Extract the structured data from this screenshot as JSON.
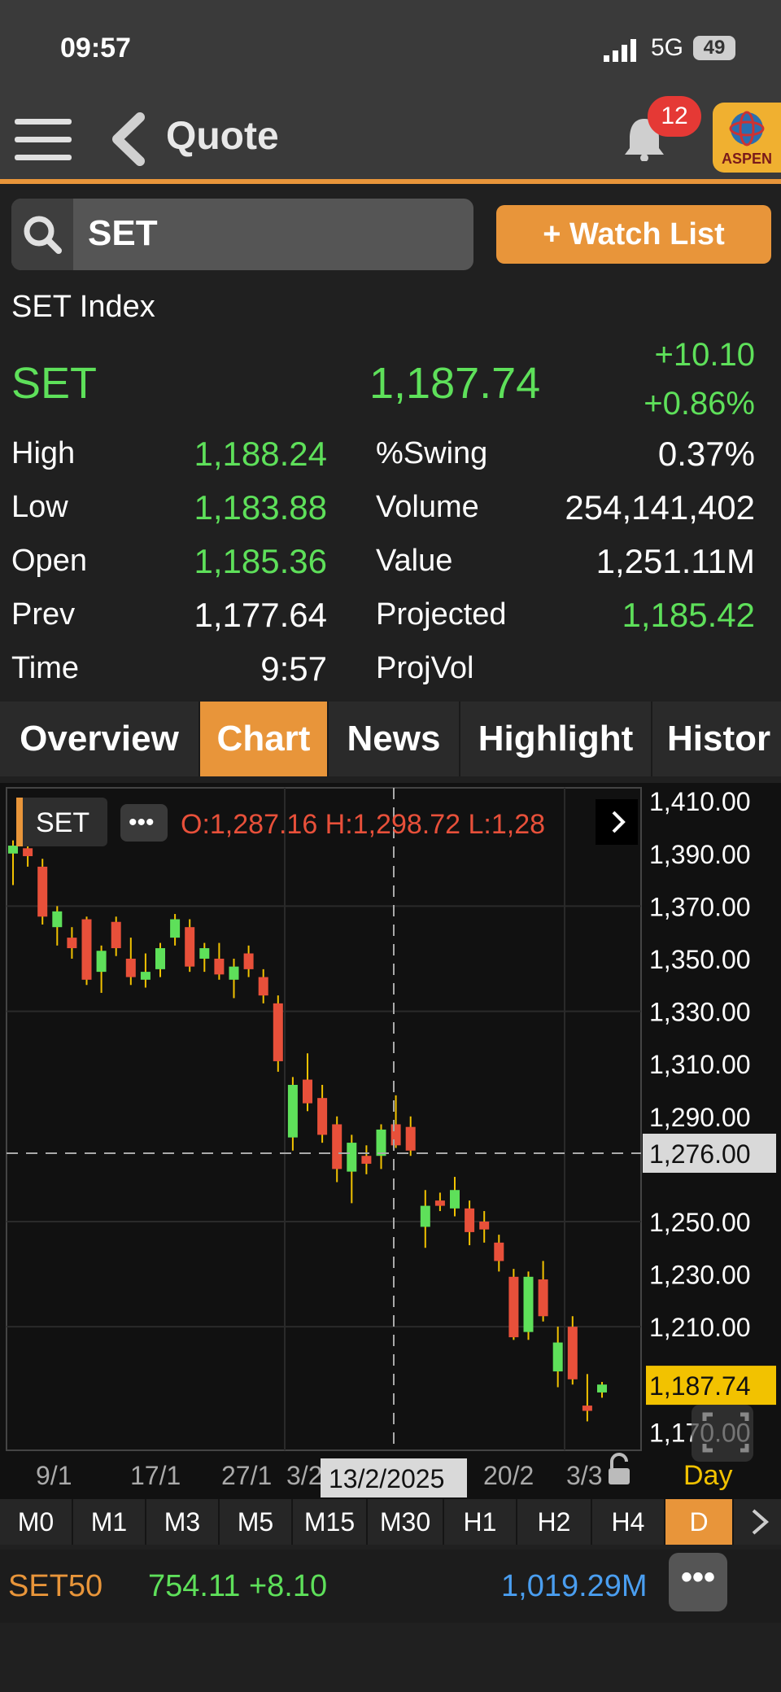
{
  "status_bar": {
    "time": "09:57",
    "network": "5G",
    "battery": "49"
  },
  "header": {
    "title": "Quote",
    "notification_count": "12",
    "logo_text": "ASPEN"
  },
  "search": {
    "value": "SET",
    "watchlist_label": "+ Watch List"
  },
  "quote": {
    "index_name": "SET Index",
    "symbol": "SET",
    "last": "1,187.74",
    "change": "+10.10",
    "change_pct": "+0.86%",
    "left_rows": [
      {
        "label": "High",
        "value": "1,188.24"
      },
      {
        "label": "Low",
        "value": "1,183.88"
      },
      {
        "label": "Open",
        "value": "1,185.36"
      },
      {
        "label": "Prev",
        "value": "1,177.64"
      },
      {
        "label": "Time",
        "value": "9:57"
      }
    ],
    "right_rows": [
      {
        "label": "%Swing",
        "value": "0.37%"
      },
      {
        "label": "Volume",
        "value": "254,141,402"
      },
      {
        "label": "Value",
        "value": "1,251.11M"
      },
      {
        "label": "Projected",
        "value": "1,185.42"
      },
      {
        "label": "ProjVol",
        "value": ""
      }
    ]
  },
  "tabs": [
    "Overview",
    "Chart",
    "News",
    "Highlight",
    "Histor"
  ],
  "active_tab": "Chart",
  "chart_header": {
    "symbol": "SET",
    "ohlc": "O:1,287.16  H:1,298.72  L:1,28"
  },
  "chart_data": {
    "type": "candlestick",
    "y_ticks": [
      "1,410.00",
      "1,390.00",
      "1,370.00",
      "1,350.00",
      "1,330.00",
      "1,310.00",
      "1,290.00",
      "1,250.00",
      "1,230.00",
      "1,210.00",
      "1,170.00"
    ],
    "ylim": [
      1163,
      1415
    ],
    "x_tick_labels": [
      "9/1",
      "17/1",
      "27/1",
      "3/2",
      "20/2",
      "3/3"
    ],
    "crosshair_price": "1,276.00",
    "crosshair_value": 1276,
    "crosshair_date": "13/2/2025",
    "last_price_label": "1,187.74",
    "last_price_value": 1187.74,
    "period_label": "Day",
    "candles": [
      {
        "o": 1390,
        "h": 1395,
        "l": 1378,
        "c": 1393,
        "up": true
      },
      {
        "o": 1392,
        "h": 1396,
        "l": 1385,
        "c": 1389,
        "up": false
      },
      {
        "o": 1385,
        "h": 1388,
        "l": 1363,
        "c": 1366,
        "up": false
      },
      {
        "o": 1362,
        "h": 1370,
        "l": 1355,
        "c": 1368,
        "up": true
      },
      {
        "o": 1358,
        "h": 1362,
        "l": 1350,
        "c": 1354,
        "up": false
      },
      {
        "o": 1365,
        "h": 1366,
        "l": 1340,
        "c": 1342,
        "up": false
      },
      {
        "o": 1345,
        "h": 1355,
        "l": 1337,
        "c": 1353,
        "up": true
      },
      {
        "o": 1364,
        "h": 1366,
        "l": 1351,
        "c": 1354,
        "up": false
      },
      {
        "o": 1350,
        "h": 1358,
        "l": 1340,
        "c": 1343,
        "up": false
      },
      {
        "o": 1342,
        "h": 1352,
        "l": 1339,
        "c": 1345,
        "up": true
      },
      {
        "o": 1346,
        "h": 1356,
        "l": 1343,
        "c": 1354,
        "up": true
      },
      {
        "o": 1358,
        "h": 1367,
        "l": 1355,
        "c": 1365,
        "up": true
      },
      {
        "o": 1362,
        "h": 1365,
        "l": 1345,
        "c": 1347,
        "up": false
      },
      {
        "o": 1350,
        "h": 1356,
        "l": 1345,
        "c": 1354,
        "up": true
      },
      {
        "o": 1350,
        "h": 1356,
        "l": 1342,
        "c": 1344,
        "up": false
      },
      {
        "o": 1342,
        "h": 1350,
        "l": 1335,
        "c": 1347,
        "up": true
      },
      {
        "o": 1352,
        "h": 1355,
        "l": 1343,
        "c": 1346,
        "up": false
      },
      {
        "o": 1343,
        "h": 1346,
        "l": 1333,
        "c": 1336,
        "up": false
      },
      {
        "o": 1333,
        "h": 1336,
        "l": 1307,
        "c": 1311,
        "up": false
      },
      {
        "o": 1282,
        "h": 1305,
        "l": 1277,
        "c": 1302,
        "up": true
      },
      {
        "o": 1304,
        "h": 1314,
        "l": 1292,
        "c": 1295,
        "up": false
      },
      {
        "o": 1297,
        "h": 1302,
        "l": 1280,
        "c": 1283,
        "up": false
      },
      {
        "o": 1287,
        "h": 1290,
        "l": 1265,
        "c": 1270,
        "up": false
      },
      {
        "o": 1269,
        "h": 1283,
        "l": 1257,
        "c": 1280,
        "up": true
      },
      {
        "o": 1275,
        "h": 1279,
        "l": 1268,
        "c": 1272,
        "up": false
      },
      {
        "o": 1275,
        "h": 1287,
        "l": 1270,
        "c": 1285,
        "up": true
      },
      {
        "o": 1287,
        "h": 1298,
        "l": 1278,
        "c": 1279,
        "up": false
      },
      {
        "o": 1286,
        "h": 1290,
        "l": 1275,
        "c": 1277,
        "up": false
      },
      {
        "o": 1256,
        "h": 1262,
        "l": 1240,
        "c": 1248,
        "up": true
      },
      {
        "o": 1258,
        "h": 1261,
        "l": 1254,
        "c": 1256,
        "up": false
      },
      {
        "o": 1255,
        "h": 1267,
        "l": 1252,
        "c": 1262,
        "up": true
      },
      {
        "o": 1255,
        "h": 1258,
        "l": 1241,
        "c": 1246,
        "up": false
      },
      {
        "o": 1250,
        "h": 1254,
        "l": 1242,
        "c": 1247,
        "up": false
      },
      {
        "o": 1242,
        "h": 1245,
        "l": 1231,
        "c": 1235,
        "up": false
      },
      {
        "o": 1229,
        "h": 1232,
        "l": 1205,
        "c": 1206,
        "up": false
      },
      {
        "o": 1208,
        "h": 1231,
        "l": 1205,
        "c": 1229,
        "up": true
      },
      {
        "o": 1228,
        "h": 1235,
        "l": 1212,
        "c": 1214,
        "up": false
      },
      {
        "o": 1193,
        "h": 1210,
        "l": 1187,
        "c": 1204,
        "up": true
      },
      {
        "o": 1210,
        "h": 1214,
        "l": 1188,
        "c": 1190,
        "up": false
      },
      {
        "o": 1180,
        "h": 1192,
        "l": 1174,
        "c": 1178,
        "up": false
      },
      {
        "o": 1185,
        "h": 1189,
        "l": 1183,
        "c": 1188,
        "up": true
      }
    ]
  },
  "timeframes": [
    "M0",
    "M1",
    "M3",
    "M5",
    "M15",
    "M30",
    "H1",
    "H2",
    "H4",
    "D"
  ],
  "active_timeframe": "D",
  "ticker": {
    "symbol": "SET50",
    "value": "754.11 +8.10",
    "volume": "1,019.29M",
    "more": "•••"
  },
  "colors": {
    "accent": "#e8953a",
    "up": "#5ee05a",
    "down": "#e8503a",
    "volume": "#4a9ef0"
  }
}
